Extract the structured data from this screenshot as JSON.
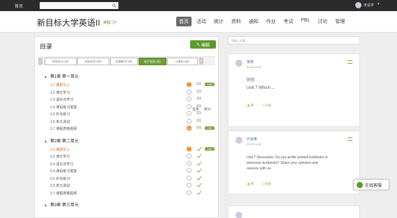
{
  "topbar": {
    "home": "首页",
    "user": "未设学"
  },
  "header": {
    "title": "新目标大学英语II",
    "subtitle": "课程门户",
    "nav": [
      "首页",
      "活动",
      "统计",
      "资料",
      "通知",
      "作业",
      "考试",
      "PBL",
      "讨论",
      "管理"
    ]
  },
  "toc": {
    "title": "目录",
    "edit_label": "编辑",
    "tabs": [
      "环境设计1班2",
      "材料科学1班2",
      "金融数学1班2",
      "电子信息1班2",
      "计算机1班2"
    ],
    "col_status": "任务",
    "col_stats": "统计",
    "chapters": [
      {
        "title": "第1章 第一单元",
        "items": [
          {
            "label": "1.1 课前引入",
            "icon": "!",
            "stat": "open",
            "pill": "100"
          },
          {
            "label": "1.2 课文学习",
            "icon": "",
            "stat": "open",
            "pill": ""
          },
          {
            "label": "1.3 语言点学习",
            "icon": "",
            "stat": "open",
            "pill": ""
          },
          {
            "label": "1.4 课后练习答案",
            "icon": "",
            "stat": "open",
            "pill": ""
          },
          {
            "label": "1.5 补充练习",
            "icon": "",
            "stat": "open",
            "pill": ""
          },
          {
            "label": "1.6 单元测试",
            "icon": "",
            "stat": "open",
            "pill": ""
          },
          {
            "label": "1.7 课程表格视频",
            "icon": "11",
            "stat": "open",
            "pill": "100"
          }
        ]
      },
      {
        "title": "第2章 第二单元",
        "items": [
          {
            "label": "2.1 课前引入",
            "icon": "!",
            "stat": "done",
            "pill": "100"
          },
          {
            "label": "2.2 课文学习",
            "icon": "",
            "stat": "done",
            "pill": ""
          },
          {
            "label": "2.3 语言点学习",
            "icon": "",
            "stat": "done",
            "pill": ""
          },
          {
            "label": "2.4 课后练习答案",
            "icon": "",
            "stat": "done",
            "pill": ""
          },
          {
            "label": "2.5 补充练习",
            "icon": "",
            "stat": "done",
            "pill": ""
          },
          {
            "label": "2.6 单元测试",
            "icon": "",
            "stat": "done",
            "pill": ""
          },
          {
            "label": "2.7 课程表格视频",
            "icon": "",
            "stat": "done",
            "pill": ""
          }
        ]
      },
      {
        "title": "第3章 第三单元",
        "items": []
      }
    ]
  },
  "right": {
    "search_placeholder": "请输入标题",
    "posts": [
      {
        "name": "李燕",
        "date": "03-26 20:11",
        "lines": [
          "职能",
          "Unit 7 Which ..."
        ],
        "like": "赞",
        "reply": "回复"
      },
      {
        "name": "亓亚琳",
        "date": "03-22 21:32",
        "lines": [
          "Unit 7 Discussion: Do you prefer printed textbooks or",
          "electronic textbooks? Share your opinions and",
          "reasons with us."
        ],
        "like": "赞",
        "reply": "回复"
      }
    ],
    "online_label": "在线客服"
  },
  "colors": {
    "accent": "#5b9a2e",
    "topbar": "#2b2b2b",
    "warning": "#f08a24"
  }
}
